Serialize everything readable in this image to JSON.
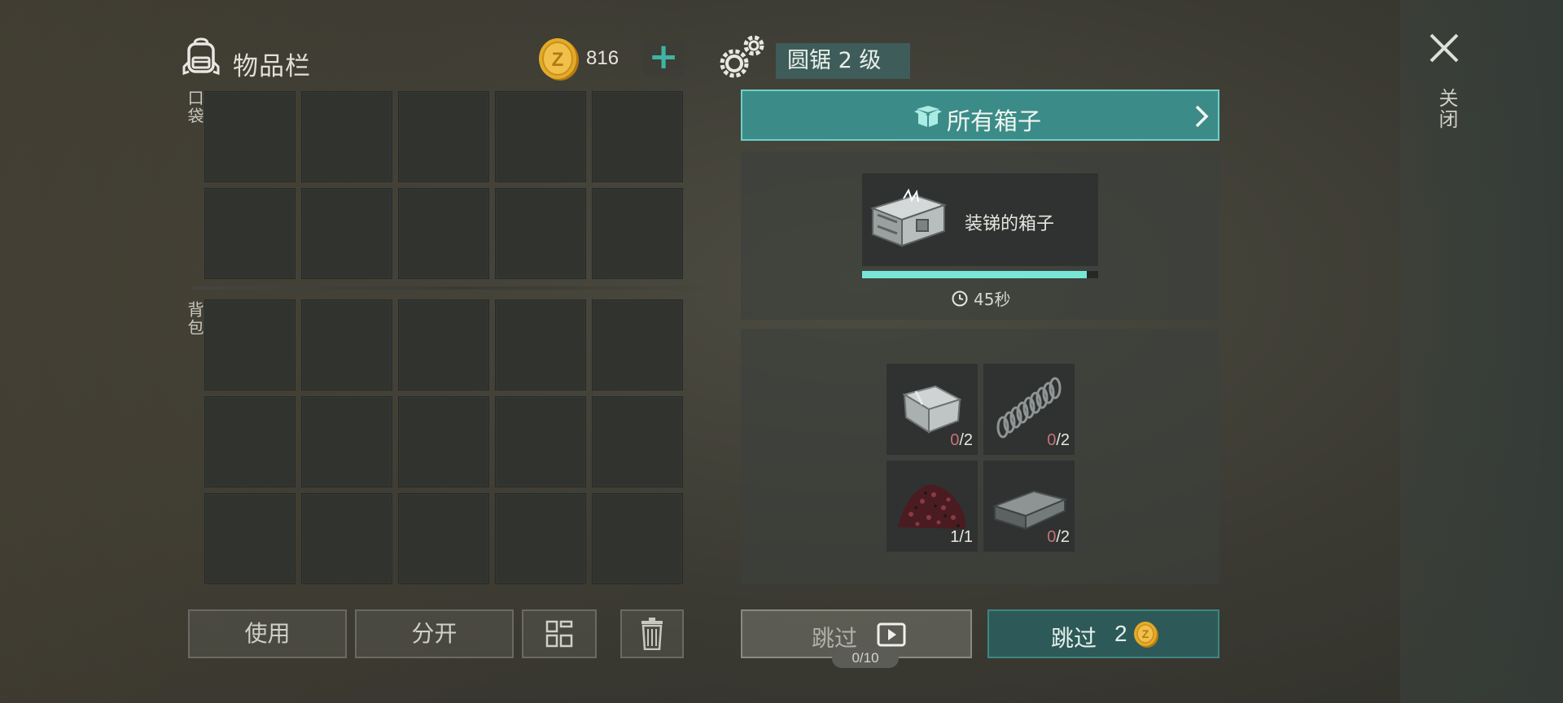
{
  "inventory": {
    "title": "物品栏",
    "coins": "816",
    "pocket_label": "口袋",
    "backpack_label": "背包",
    "pocket_slots": 10,
    "backpack_slots": 15,
    "use_label": "使用",
    "split_label": "分开"
  },
  "workbench": {
    "level": "圆锯 2 级",
    "all_boxes_label": "所有箱子",
    "product": {
      "name": "装锑的箱子",
      "time_left": "45秒",
      "progress": 0.95
    },
    "ingredients": [
      {
        "icon": "metal-sheet-icon",
        "have": "0",
        "need": "/2"
      },
      {
        "icon": "spring-icon",
        "have": "0",
        "need": "/2"
      },
      {
        "icon": "ore-pile-icon",
        "have": "1",
        "need": "/1"
      },
      {
        "icon": "metal-ingot-icon",
        "have": "0",
        "need": "/2"
      }
    ],
    "skip_ad_label": "跳过",
    "ad_counter": "0/10",
    "skip_pay_label": "跳过",
    "skip_pay_cost": "2"
  },
  "close_label": "关闭",
  "colors": {
    "accent_teal": "#3b8c88",
    "progress": "#78e6d6",
    "coin_gold": "#e0a823",
    "missing_count": "#c8707a"
  }
}
